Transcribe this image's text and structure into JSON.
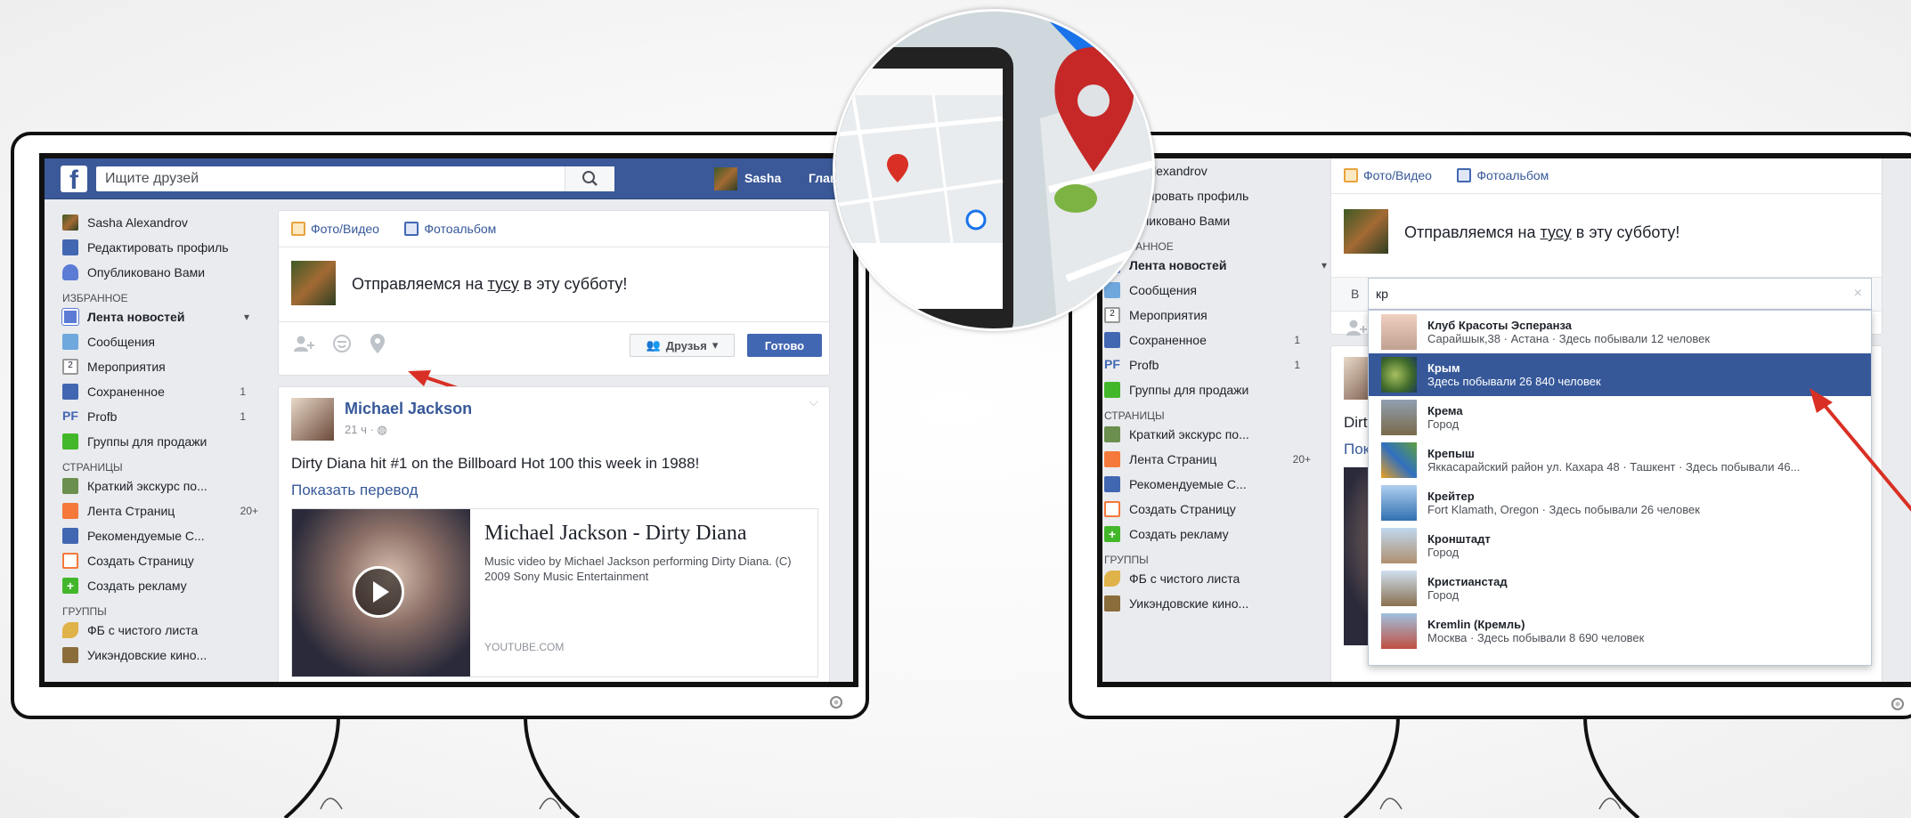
{
  "left": {
    "search_placeholder": "Ищите друзей",
    "user_name": "Sasha",
    "home_label": "Главн",
    "sidebar": {
      "profile_name": "Sasha Alexandrov",
      "edit_profile": "Редактировать профиль",
      "published": "Опубликовано Вами",
      "favorites_header": "ИЗБРАННОЕ",
      "favorites": [
        {
          "label": "Лента новостей",
          "count": ""
        },
        {
          "label": "Сообщения",
          "count": ""
        },
        {
          "label": "Мероприятия",
          "count": ""
        },
        {
          "label": "Сохраненное",
          "count": "1"
        },
        {
          "label": "Profb",
          "count": "1"
        },
        {
          "label": "Группы для продажи",
          "count": ""
        }
      ],
      "pages_header": "СТРАНИЦЫ",
      "pages": [
        {
          "label": "Краткий экскурс по...",
          "count": ""
        },
        {
          "label": "Лента Страниц",
          "count": "20+"
        },
        {
          "label": "Рекомендуемые С...",
          "count": ""
        },
        {
          "label": "Создать Страницу",
          "count": ""
        },
        {
          "label": "Создать рекламу",
          "count": ""
        }
      ],
      "groups_header": "ГРУППЫ",
      "groups": [
        {
          "label": "ФБ с чистого листа"
        },
        {
          "label": "Уикэндовские кино..."
        }
      ]
    },
    "composer": {
      "photo_video": "Фото/Видео",
      "album": "Фотоальбом",
      "text_before": "Отправляемся на ",
      "text_link": "тусу",
      "text_after": " в эту субботу!",
      "audience": "Друзья",
      "done": "Готово"
    },
    "post": {
      "author": "Michael Jackson",
      "time": "21 ч · ",
      "text": "Dirty Diana hit #1 on the Billboard Hot 100 this week in 1988!",
      "translate": "Показать перевод",
      "link_title": "Michael Jackson - Dirty Diana",
      "link_desc": "Music video by Michael Jackson performing Dirty Diana. (C) 2009 Sony Music Entertainment",
      "link_domain": "YOUTUBE.COM"
    }
  },
  "right": {
    "sidebar": {
      "profile_name": "sha Alexandrov",
      "edit_profile": "дактировать профиль",
      "published": "публиковано Вами",
      "favorites_header": "БРАННОЕ",
      "favorites": [
        {
          "label": "Лента новостей",
          "count": ""
        },
        {
          "label": "Сообщения",
          "count": ""
        },
        {
          "label": "Мероприятия",
          "count": ""
        },
        {
          "label": "Сохраненное",
          "count": "1"
        },
        {
          "label": "Profb",
          "count": "1"
        },
        {
          "label": "Группы для продажи",
          "count": ""
        }
      ],
      "pages_header": "СТРАНИЦЫ",
      "pages": [
        {
          "label": "Краткий экскурс по...",
          "count": ""
        },
        {
          "label": "Лента Страниц",
          "count": "20+"
        },
        {
          "label": "Рекомендуемые С...",
          "count": ""
        },
        {
          "label": "Создать Страницу",
          "count": ""
        },
        {
          "label": "Создать рекламу",
          "count": ""
        }
      ],
      "groups_header": "ГРУППЫ",
      "groups": [
        {
          "label": "ФБ с чистого листа"
        },
        {
          "label": "Уикэндовские кино..."
        }
      ]
    },
    "composer": {
      "photo_video": "Фото/Видео",
      "album": "Фотоальбом",
      "text_before": "Отправляемся на ",
      "text_link": "тусу",
      "text_after": " в эту субботу!",
      "location_prefix": "В",
      "location_query": "кр",
      "clear": "×"
    },
    "post_fragments": {
      "text": "Dirty",
      "translate": "Пока"
    },
    "dropdown": [
      {
        "title": "Клуб Красоты Эсперанза",
        "subtitle": "Сарайшык,38 · Астана · Здесь побывали 12 человек",
        "selected": false
      },
      {
        "title": "Крым",
        "subtitle": "Здесь побывали 26 840 человек",
        "selected": true
      },
      {
        "title": "Крема",
        "subtitle": "Город",
        "selected": false
      },
      {
        "title": "Крепыш",
        "subtitle": "Яккасарайский район ул. Кахара 48 · Ташкент · Здесь побывали 46...",
        "selected": false
      },
      {
        "title": "Крейтер",
        "subtitle": "Fort Klamath, Oregon · Здесь побывали 26 человек",
        "selected": false
      },
      {
        "title": "Кронштадт",
        "subtitle": "Город",
        "selected": false
      },
      {
        "title": "Кристианстад",
        "subtitle": "Город",
        "selected": false
      },
      {
        "title": "Kremlin (Кремль)",
        "subtitle": "Москва · Здесь побывали 8 690 человек",
        "selected": false
      }
    ]
  },
  "colors": {
    "facebook_blue": "#3b5998",
    "link_blue": "#365899",
    "button_blue": "#4267b2",
    "arrow_red": "#d93025"
  }
}
